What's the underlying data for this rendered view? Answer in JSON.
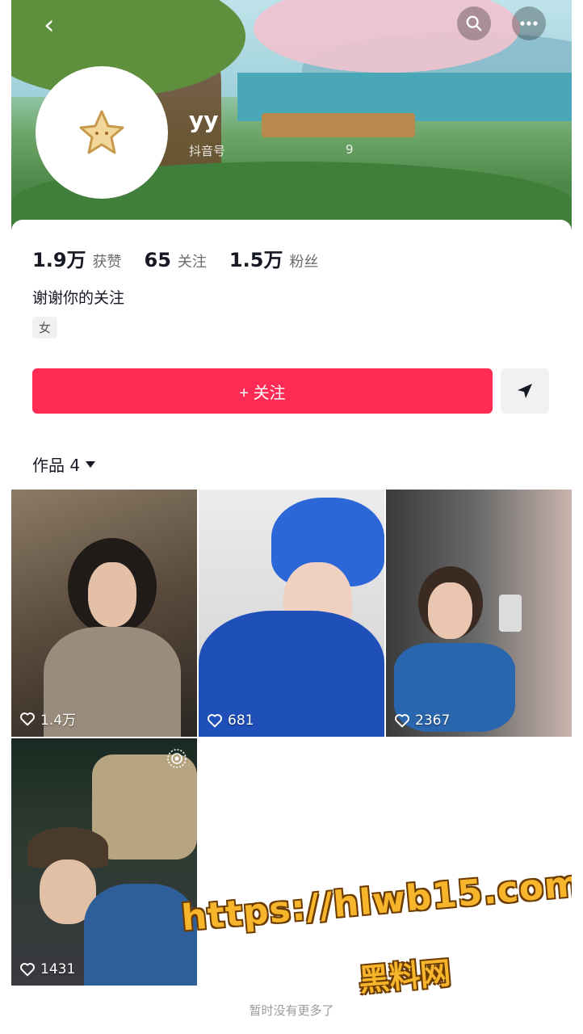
{
  "header": {
    "back_label": "‹",
    "name": "yy",
    "id_label": "抖音号",
    "id_suffix": "9"
  },
  "profile": {
    "stats": [
      {
        "num": "1.9万",
        "label": "获赞"
      },
      {
        "num": "65",
        "label": "关注"
      },
      {
        "num": "1.5万",
        "label": "粉丝"
      }
    ],
    "bio": "谢谢你的关注",
    "gender_tag": "女"
  },
  "actions": {
    "follow_label": "+ 关注"
  },
  "works": {
    "label": "作品 4",
    "items": [
      {
        "likes": "1.4万"
      },
      {
        "likes": "681"
      },
      {
        "likes": "2367"
      },
      {
        "likes": "1431"
      }
    ]
  },
  "footer": {
    "no_more": "暂时没有更多了"
  },
  "watermark": {
    "url": "https://hlwb15.com",
    "site": "黑料网"
  },
  "colors": {
    "accent": "#fe2c55"
  }
}
